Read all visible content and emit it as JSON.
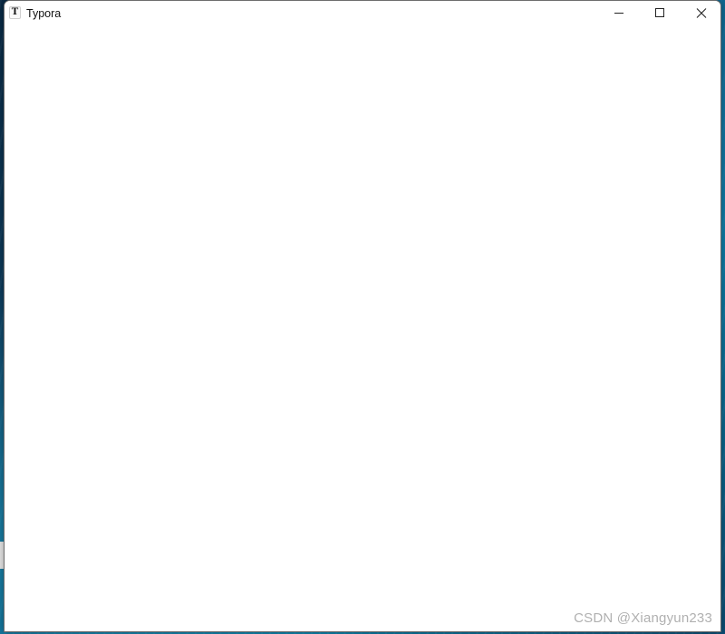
{
  "window": {
    "title": "Typora",
    "app_icon_glyph": "T",
    "controls": {
      "minimize_icon": "minimize-icon",
      "maximize_icon": "maximize-icon",
      "close_icon": "close-icon"
    }
  },
  "watermark": {
    "text": "CSDN @Xiangyun233"
  },
  "colors": {
    "window_background": "#ffffff",
    "desktop_accent": "#0b5f86"
  }
}
